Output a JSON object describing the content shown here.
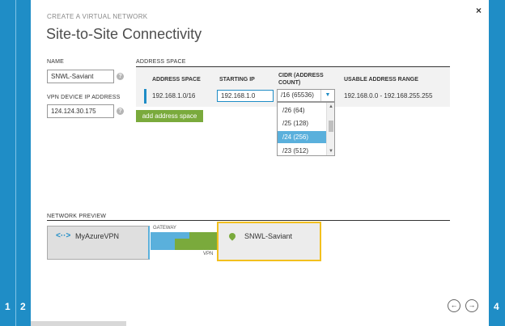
{
  "wizard": {
    "subtitle": "CREATE A VIRTUAL NETWORK",
    "title": "Site-to-Site Connectivity",
    "close_symbol": "×",
    "steps_left": [
      "1",
      "2"
    ],
    "steps_right": [
      "4"
    ]
  },
  "form": {
    "name_label": "NAME",
    "name_value": "SNWL-Saviant",
    "vpn_ip_label": "VPN DEVICE IP ADDRESS",
    "vpn_ip_value": "124.124.30.175",
    "help_symbol": "?"
  },
  "address_space": {
    "section_label": "ADDRESS SPACE",
    "columns": [
      "ADDRESS SPACE",
      "STARTING IP",
      "CIDR (ADDRESS",
      "COUNT)",
      "USABLE ADDRESS RANGE"
    ],
    "row": {
      "address_space": "192.168.1.0/16",
      "starting_ip": "192.168.1.0",
      "cidr": "/16 (65536)",
      "usable_range": "192.168.0.0 - 192.168.255.255"
    },
    "add_button": "add address space",
    "cidr_options": [
      "/26 (64)",
      "/25 (128)",
      "/24 (256)",
      "/23 (512)"
    ],
    "cidr_highlighted": "/24 (256)"
  },
  "preview": {
    "section_label": "NETWORK PREVIEW",
    "azure_name": "MyAzureVPN",
    "site_name": "SNWL-Saviant",
    "gateway_label": "GATEWAY",
    "vpn_label": "VPN"
  },
  "nav": {
    "back_symbol": "←",
    "next_symbol": "→"
  },
  "colors": {
    "rail": "#1f8dc6",
    "accent_green": "#7aaa3c",
    "highlight_blue": "#5ab0dc",
    "site_border": "#f2c01e"
  }
}
